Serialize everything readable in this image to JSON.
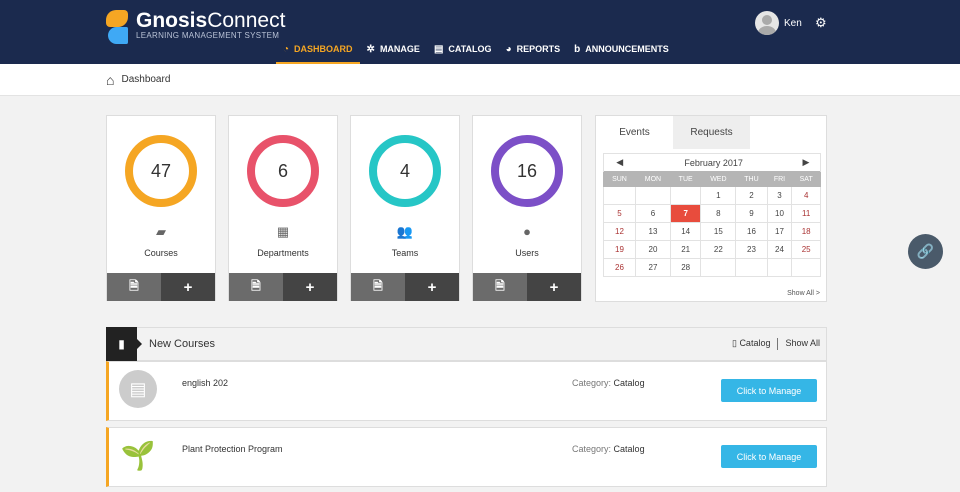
{
  "brand": {
    "name_bold": "Gnosis",
    "name_rest": "Connect",
    "tagline": "LEARNING MANAGEMENT SYSTEM"
  },
  "nav": [
    {
      "label": "DASHBOARD",
      "icon": "gauge-icon",
      "active": true
    },
    {
      "label": "MANAGE",
      "icon": "network-icon"
    },
    {
      "label": "CATALOG",
      "icon": "catalog-icon"
    },
    {
      "label": "REPORTS",
      "icon": "pie-chart-icon"
    },
    {
      "label": "ANNOUNCEMENTS",
      "icon": "announcement-icon"
    }
  ],
  "user": {
    "name": "Ken"
  },
  "breadcrumb": {
    "label": "Dashboard"
  },
  "stats": [
    {
      "value": "47",
      "label": "Courses",
      "color": "#f5a623",
      "icon": "book-icon"
    },
    {
      "value": "6",
      "label": "Departments",
      "color": "#e8526a",
      "icon": "grid-icon"
    },
    {
      "value": "4",
      "label": "Teams",
      "color": "#26c6c6",
      "icon": "team-icon"
    },
    {
      "value": "16",
      "label": "Users",
      "color": "#7c4fc7",
      "icon": "user-icon"
    }
  ],
  "calendar": {
    "tabs": [
      "Events",
      "Requests"
    ],
    "month": "February 2017",
    "weekdays": [
      "SUN",
      "MON",
      "TUE",
      "WED",
      "THU",
      "FRI",
      "SAT"
    ],
    "weeks": [
      [
        "",
        "",
        "",
        "1",
        "2",
        "3",
        "4"
      ],
      [
        "5",
        "6",
        "7",
        "8",
        "9",
        "10",
        "11"
      ],
      [
        "12",
        "13",
        "14",
        "15",
        "16",
        "17",
        "18"
      ],
      [
        "19",
        "20",
        "21",
        "22",
        "23",
        "24",
        "25"
      ],
      [
        "26",
        "27",
        "28",
        "",
        "",
        "",
        ""
      ]
    ],
    "today": "7",
    "show_all": "Show All >"
  },
  "new_courses": {
    "title": "New Courses",
    "catalog_link": "Catalog",
    "show_all": "Show All",
    "items": [
      {
        "name": "english 202",
        "category_label": "Category:",
        "category": "Catalog",
        "button": "Click to Manage"
      },
      {
        "name": "Plant Protection Program",
        "category_label": "Category:",
        "category": "Catalog",
        "button": "Click to Manage"
      }
    ]
  }
}
